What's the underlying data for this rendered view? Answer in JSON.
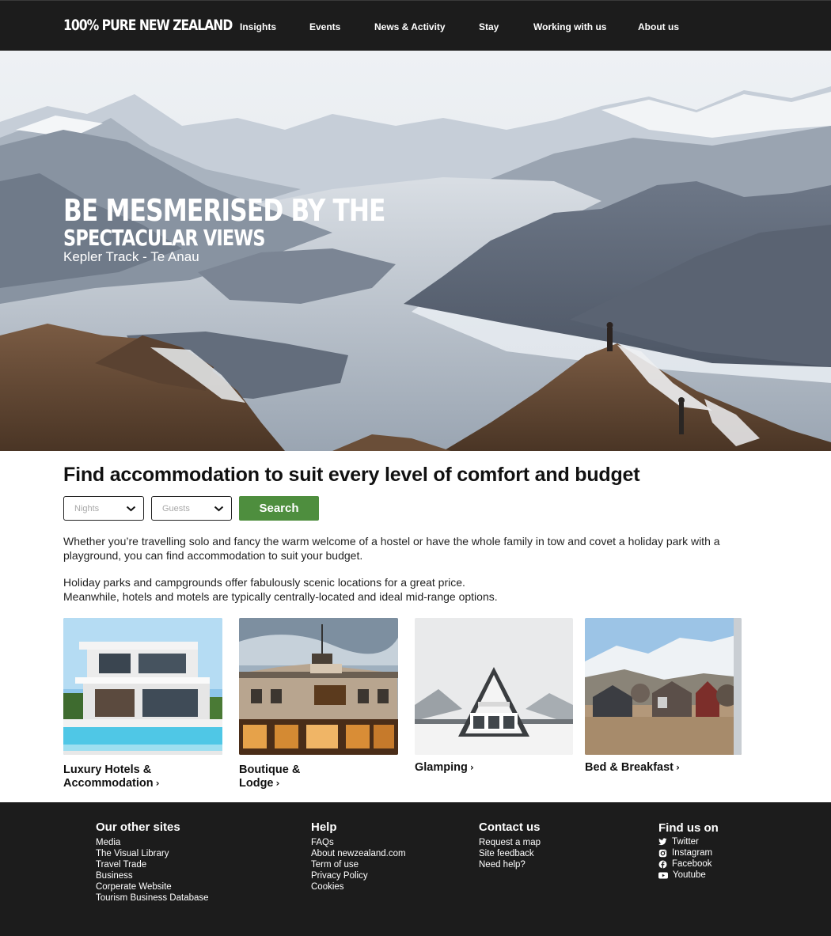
{
  "nav": {
    "logo": "100% PURE NEW ZEALAND",
    "links": [
      "Insights",
      "Events",
      "News & Activity",
      "Stay",
      "Working with us",
      "About us"
    ]
  },
  "hero": {
    "title_line1": "Be mesmerised by the",
    "title_line2": "Spectacular views",
    "subtitle": "Kepler Track - Te Anau"
  },
  "main": {
    "title": "Find accommodation to suit every level of comfort and budget",
    "nights_placeholder": "Nights",
    "guests_placeholder": "Guests",
    "search_label": "Search",
    "paragraph1": "Whether you’re travelling solo and fancy the warm welcome of a hostel or have the whole family in tow and covet a holiday park with a playground, you can find accommodation to suit your budget.",
    "paragraph2_line1": "Holiday parks and campgrounds offer fabulously scenic locations for a great price.",
    "paragraph2_line2": "Meanwhile, hotels and motels are typically centrally-located and ideal mid-range options."
  },
  "cards": [
    {
      "line1": "Luxury Hotels &",
      "line2": "Accommodation"
    },
    {
      "line1": "Boutique &",
      "line2": "Lodge"
    },
    {
      "line1": "Glamping",
      "line2": ""
    },
    {
      "line1": "Bed & Breakfast",
      "line2": ""
    }
  ],
  "footer": {
    "other_sites": {
      "heading": "Our other sites",
      "links": [
        "Media",
        "The Visual Library",
        "Travel Trade",
        "Business",
        "Corperate Website",
        "Tourism Business Database"
      ]
    },
    "help": {
      "heading": "Help",
      "links": [
        "FAQs",
        "About newzealand.com",
        "Term of use",
        "Privacy Policy",
        "Cookies"
      ]
    },
    "contact": {
      "heading": "Contact us",
      "links": [
        "Request a map",
        "Site feedback",
        "Need help?"
      ]
    },
    "social": {
      "heading": "Find us on",
      "links": [
        {
          "label": "Twitter",
          "icon": "twitter-icon"
        },
        {
          "label": "Instagram",
          "icon": "instagram-icon"
        },
        {
          "label": "Facebook",
          "icon": "facebook-icon"
        },
        {
          "label": "Youtube",
          "icon": "youtube-icon"
        }
      ]
    }
  },
  "colors": {
    "nav_bg": "#1c1c1c",
    "footer_bg": "#1c1c1c",
    "search_button": "#4e8e3e",
    "text": "#111111"
  }
}
